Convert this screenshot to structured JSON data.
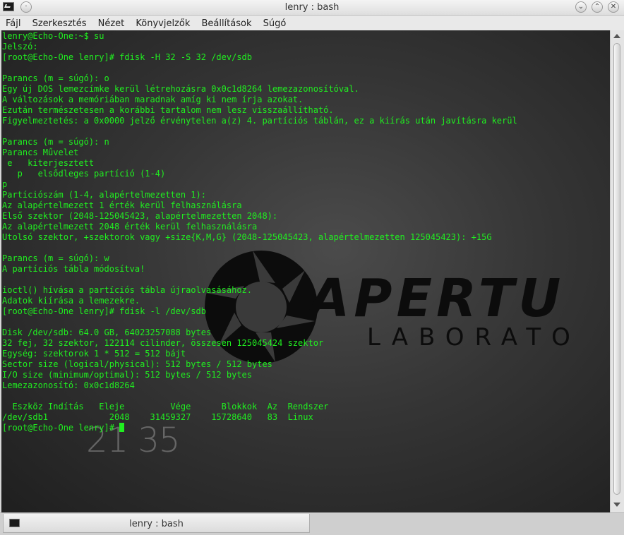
{
  "window": {
    "title": "lenry : bash",
    "icon": "terminal-icon",
    "controls": [
      "minimize-icon",
      "maximize-icon",
      "close-icon"
    ]
  },
  "menu": {
    "items": [
      "Fájl",
      "Szerkesztés",
      "Nézet",
      "Könyvjelzők",
      "Beállítások",
      "Súgó"
    ]
  },
  "terminal": {
    "lines": [
      "lenry@Echo-One:~$ su",
      "Jelszó:",
      "[root@Echo-One lenry]# fdisk -H 32 -S 32 /dev/sdb",
      "",
      "Parancs (m = súgó): o",
      "Egy új DOS lemezcímke kerül létrehozásra 0x0c1d8264 lemezazonosítóval.",
      "A változások a memóriában maradnak amíg ki nem írja azokat.",
      "Ezután természetesen a korábbi tartalom nem lesz visszaállítható.",
      "Figyelmeztetés: a 0x0000 jelző érvénytelen a(z) 4. partíciós táblán, ez a kiírás után javításra kerül",
      "",
      "Parancs (m = súgó): n",
      "Parancs Művelet",
      " e   kiterjesztett",
      "   p   elsődleges partíció (1-4)",
      "p",
      "Partíciószám (1-4, alapértelmezetten 1):",
      "Az alapértelmezett 1 érték kerül felhasználásra",
      "Első szektor (2048-125045423, alapértelmezetten 2048):",
      "Az alapértelmezett 2048 érték kerül felhasználásra",
      "Utolsó szektor, +szektorok vagy +size{K,M,G} (2048-125045423, alapértelmezetten 125045423): +15G",
      "",
      "Parancs (m = súgó): w",
      "A partíciós tábla módosítva!",
      "",
      "ioctl() hívása a partíciós tábla újraolvasásához.",
      "Adatok kiírása a lemezekre.",
      "[root@Echo-One lenry]# fdisk -l /dev/sdb",
      "",
      "Disk /dev/sdb: 64.0 GB, 64023257088 bytes",
      "32 fej, 32 szektor, 122114 cilinder, összesen 125045424 szektor",
      "Egység: szektorok 1 * 512 = 512 bájt",
      "Sector size (logical/physical): 512 bytes / 512 bytes",
      "I/O size (minimum/optimal): 512 bytes / 512 bytes",
      "Lemezazonosító: 0x0c1d8264",
      "",
      "  Eszköz Indítás   Eleje         Vége      Blokkok  Az  Rendszer",
      "/dev/sdb1            2048    31459327    15728640   83  Linux"
    ],
    "prompt": "[root@Echo-One lenry]# ",
    "text_color": "#20ee20"
  },
  "background": {
    "logo_wordmark": "APERTU",
    "logo_subtitle": "LABORATO",
    "clock": "21 35"
  },
  "tabs": [
    {
      "label": "lenry : bash",
      "icon": "terminal-icon"
    }
  ]
}
